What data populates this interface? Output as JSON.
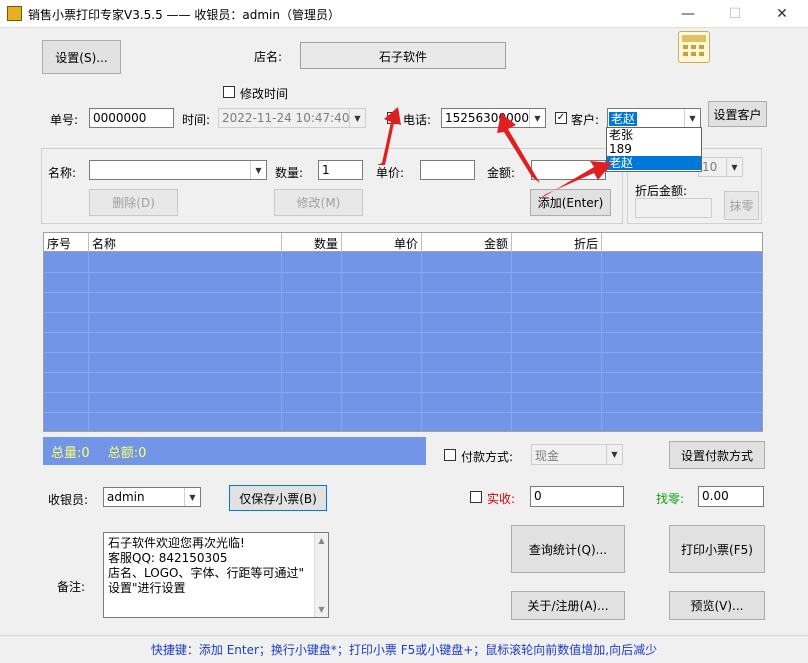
{
  "window": {
    "title": "销售小票打印专家V3.5.5 —— 收银员：admin（管理员）",
    "minimize": "—",
    "maximize": "☐",
    "close": "✕"
  },
  "top": {
    "settings_label": "设置(S)...",
    "store_label": "店名:",
    "store_name": "石子软件",
    "modify_time_label": "修改时间",
    "modify_time_checked": false
  },
  "order": {
    "order_no_label": "单号:",
    "order_no": "0000000",
    "time_label": "时间:",
    "time_value": "2022-11-24 10:47:40",
    "phone_checked": true,
    "phone_label": "电话:",
    "phone_value": "15256300000",
    "customer_checked": true,
    "customer_label": "客户:",
    "customer_value": "老赵",
    "set_customer_label": "设置客户",
    "customer_options": [
      "老张",
      "189",
      "老赵"
    ],
    "customer_selected_index": 2
  },
  "item": {
    "name_label": "名称:",
    "name_value": "",
    "qty_label": "数量:",
    "qty_value": "1",
    "price_label": "单价:",
    "price_value": "",
    "amount_label": "金额:",
    "amount_value": "",
    "discount_value": "10",
    "discounted_amount_label": "折后金额:",
    "delete_label": "删除(D)",
    "modify_label": "修改(M)",
    "add_label": "添加(Enter)",
    "round_label": "抹零"
  },
  "table": {
    "columns": [
      "序号",
      "名称",
      "数量",
      "单价",
      "金额",
      "折后"
    ],
    "row_count": 9
  },
  "summary": {
    "total_qty": "总量:0",
    "total_amount": "总额:0"
  },
  "payment": {
    "method_label": "付款方式:",
    "method_checked": false,
    "method_value": "现金",
    "set_method_label": "设置付款方式",
    "received_label": "实收:",
    "received_checked": false,
    "received_value": "0",
    "change_label": "找零:",
    "change_value": "0.00"
  },
  "cashier": {
    "label": "收银员:",
    "value": "admin",
    "save_only_label": "仅保存小票(B)"
  },
  "actions": {
    "query_label": "查询统计(Q)...",
    "print_label": "打印小票(F5)",
    "about_label": "关于/注册(A)...",
    "preview_label": "预览(V)..."
  },
  "note": {
    "label": "备注:",
    "line1": "石子软件欢迎您再次光临!",
    "line2": "客服QQ: 842150305",
    "line3": "店名、LOGO、字体、行距等可通过\"",
    "line4": "设置\"进行设置"
  },
  "status": {
    "text": "快捷键：添加 Enter；换行小键盘*；打印小票 F5或小键盘+；鼠标滚轮向前数值增加,向后减少"
  },
  "colors": {
    "grid_bg": "#7395e8",
    "summary_text": "#ffff66",
    "received_label": "#d00000",
    "change_label": "#10a010",
    "status_text": "#1a3cc8",
    "annotation_arrow": "#e02020"
  }
}
